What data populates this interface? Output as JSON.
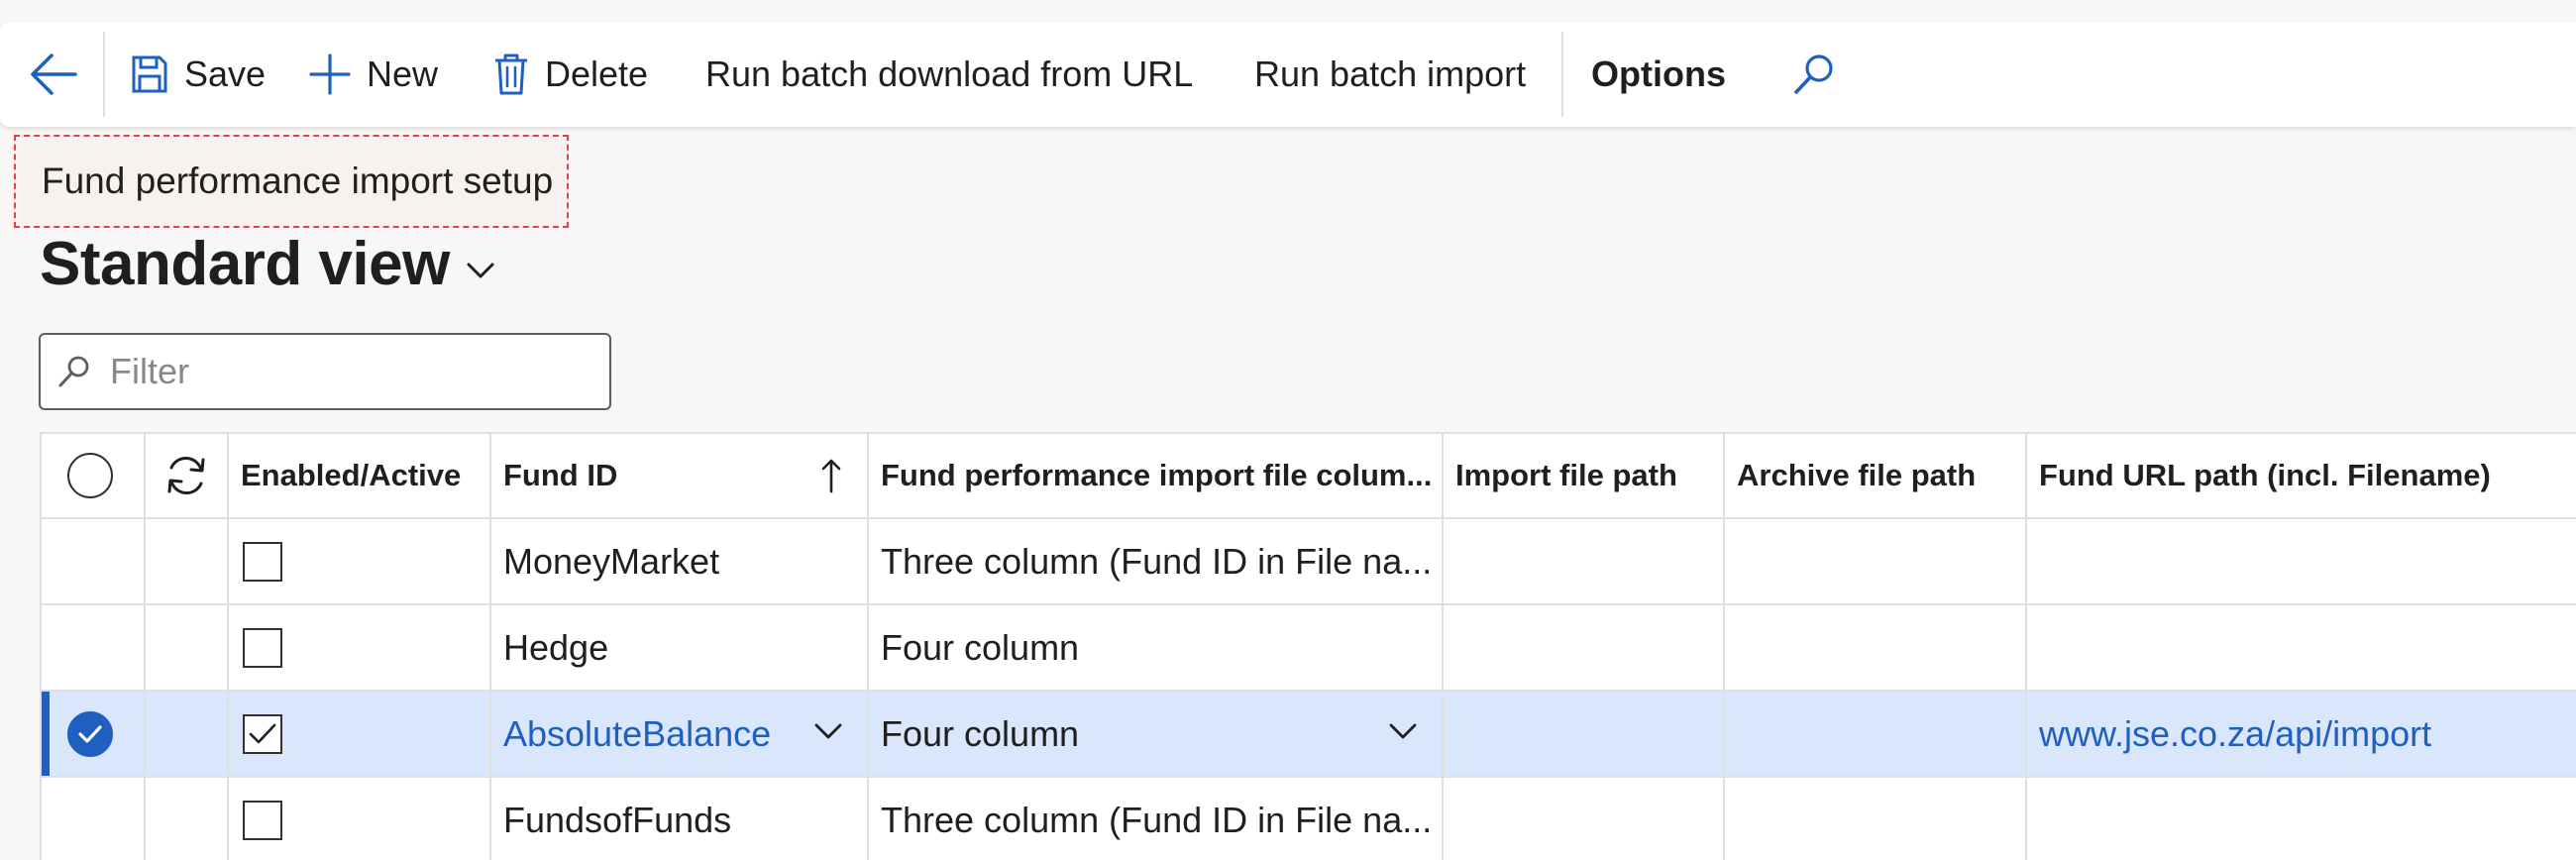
{
  "actionpane": {
    "save_label": "Save",
    "new_label": "New",
    "delete_label": "Delete",
    "run_download_label": "Run batch download from URL",
    "run_import_label": "Run batch import",
    "options_label": "Options"
  },
  "page": {
    "caption": "Fund performance import setup",
    "view_name": "Standard view"
  },
  "filter": {
    "placeholder": "Filter"
  },
  "grid": {
    "columns": {
      "enabled": "Enabled/Active",
      "fund_id": "Fund ID",
      "columns_format": "Fund performance import file colum...",
      "import_path": "Import file path",
      "archive_path": "Archive file path",
      "url_path": "Fund URL path (incl. Filename)"
    },
    "rows": [
      {
        "enabled": false,
        "fund_id": "MoneyMarket",
        "format": "Three column (Fund ID in File na...",
        "import_path": "",
        "archive_path": "",
        "url_path": ""
      },
      {
        "enabled": false,
        "fund_id": "Hedge",
        "format": "Four column",
        "import_path": "",
        "archive_path": "",
        "url_path": ""
      },
      {
        "enabled": true,
        "fund_id": "AbsoluteBalance",
        "format": "Four column",
        "import_path": "",
        "archive_path": "",
        "url_path": "www.jse.co.za/api/import"
      },
      {
        "enabled": false,
        "fund_id": "FundsofFunds",
        "format": "Three column (Fund ID in File na...",
        "import_path": "",
        "archive_path": "",
        "url_path": ""
      }
    ]
  },
  "colors": {
    "accent": "#1f5fbf",
    "selected_row": "#dae6fb",
    "caption_highlight": "#e4404a"
  }
}
